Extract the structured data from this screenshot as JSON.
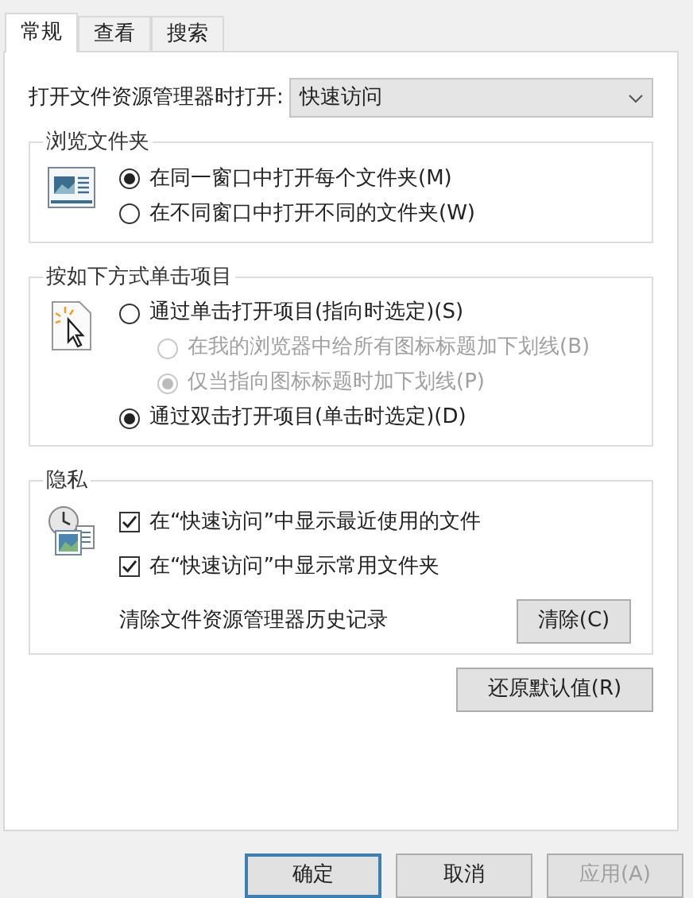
{
  "tabs": [
    {
      "label": "常规",
      "selected": true
    },
    {
      "label": "查看",
      "selected": false
    },
    {
      "label": "搜索",
      "selected": false
    }
  ],
  "open_in": {
    "label": "打开文件资源管理器时打开:",
    "value": "快速访问"
  },
  "groups": [
    {
      "title": "浏览文件夹",
      "items": [
        {
          "kind": "radio",
          "label": "在同一窗口中打开每个文件夹(M)",
          "selected": true,
          "disabled": false
        },
        {
          "kind": "radio",
          "label": "在不同窗口中打开不同的文件夹(W)",
          "selected": false,
          "disabled": false
        }
      ]
    },
    {
      "title": "按如下方式单击项目",
      "items": [
        {
          "kind": "radio",
          "label": "通过单击打开项目(指向时选定)(S)",
          "selected": false,
          "disabled": false,
          "children": [
            {
              "kind": "radio",
              "label": "在我的浏览器中给所有图标标题加下划线(B)",
              "selected": false,
              "disabled": true
            },
            {
              "kind": "radio",
              "label": "仅当指向图标标题时加下划线(P)",
              "selected": true,
              "disabled": true
            }
          ]
        },
        {
          "kind": "radio",
          "label": "通过双击打开项目(单击时选定)(D)",
          "selected": true,
          "disabled": false
        }
      ]
    },
    {
      "title": "隐私",
      "items": [
        {
          "kind": "checkbox",
          "label": "在“快速访问”中显示最近使用的文件",
          "checked": true
        },
        {
          "kind": "checkbox",
          "label": "在“快速访问”中显示常用文件夹",
          "checked": true
        },
        {
          "kind": "action",
          "label": "清除文件资源管理器历史记录",
          "button": "清除(C)"
        }
      ]
    }
  ],
  "restore_button": "还原默认值(R)",
  "buttons": [
    {
      "label": "确定",
      "default": true,
      "disabled": false
    },
    {
      "label": "取消",
      "default": false,
      "disabled": false
    },
    {
      "label": "应用(A)",
      "default": false,
      "disabled": true
    }
  ]
}
